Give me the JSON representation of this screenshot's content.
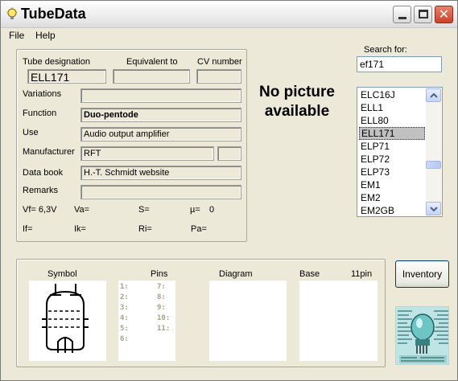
{
  "window": {
    "title": "TubeData"
  },
  "menu": {
    "file": "File",
    "help": "Help"
  },
  "main": {
    "header_labels": {
      "designation": "Tube designation",
      "equivalent": "Equivalent to",
      "cv": "CV number"
    },
    "designation_value": "ELL171",
    "equivalent_value": "",
    "cv_value": "",
    "rows": {
      "variations": {
        "label": "Variations",
        "value": ""
      },
      "function": {
        "label": "Function",
        "value": "Duo-pentode"
      },
      "use": {
        "label": "Use",
        "value": "Audio output amplifier"
      },
      "manufacturer": {
        "label": "Manufacturer",
        "value": "RFT",
        "extra": ""
      },
      "databook": {
        "label": "Data book",
        "value": "H.-T. Schmidt website"
      },
      "remarks": {
        "label": "Remarks",
        "value": ""
      }
    },
    "params": {
      "vf": "Vf= 6,3V",
      "va": "Va=",
      "s": "S=",
      "mu": "µ=",
      "mu_value": "0",
      "if": "If=",
      "ik": "Ik=",
      "ri": "Ri=",
      "pa": "Pa="
    }
  },
  "picture": {
    "no_picture_text": "No picture available"
  },
  "search": {
    "label": "Search for:",
    "value": "ef171"
  },
  "tube_list": {
    "items": [
      "ELC16J",
      "ELL1",
      "ELL80",
      "ELL171",
      "ELP71",
      "ELP72",
      "ELP73",
      "EM1",
      "EM2",
      "EM2GB"
    ],
    "selected": "ELL171"
  },
  "bottom": {
    "symbol_label": "Symbol",
    "pins_label": "Pins",
    "diagram_label": "Diagram",
    "base_label": "Base",
    "base_value": "11pin",
    "pins_left": [
      "1:",
      "2:",
      "3:",
      "4:",
      "5:",
      "6:"
    ],
    "pins_right": [
      "7:",
      "8:",
      "9:",
      "10:",
      "11:"
    ]
  },
  "inventory_button": "Inventory",
  "colors": {
    "selection": "#c1c1c1",
    "window_bg": "#ece9d8",
    "close_button": "#c9432a"
  }
}
